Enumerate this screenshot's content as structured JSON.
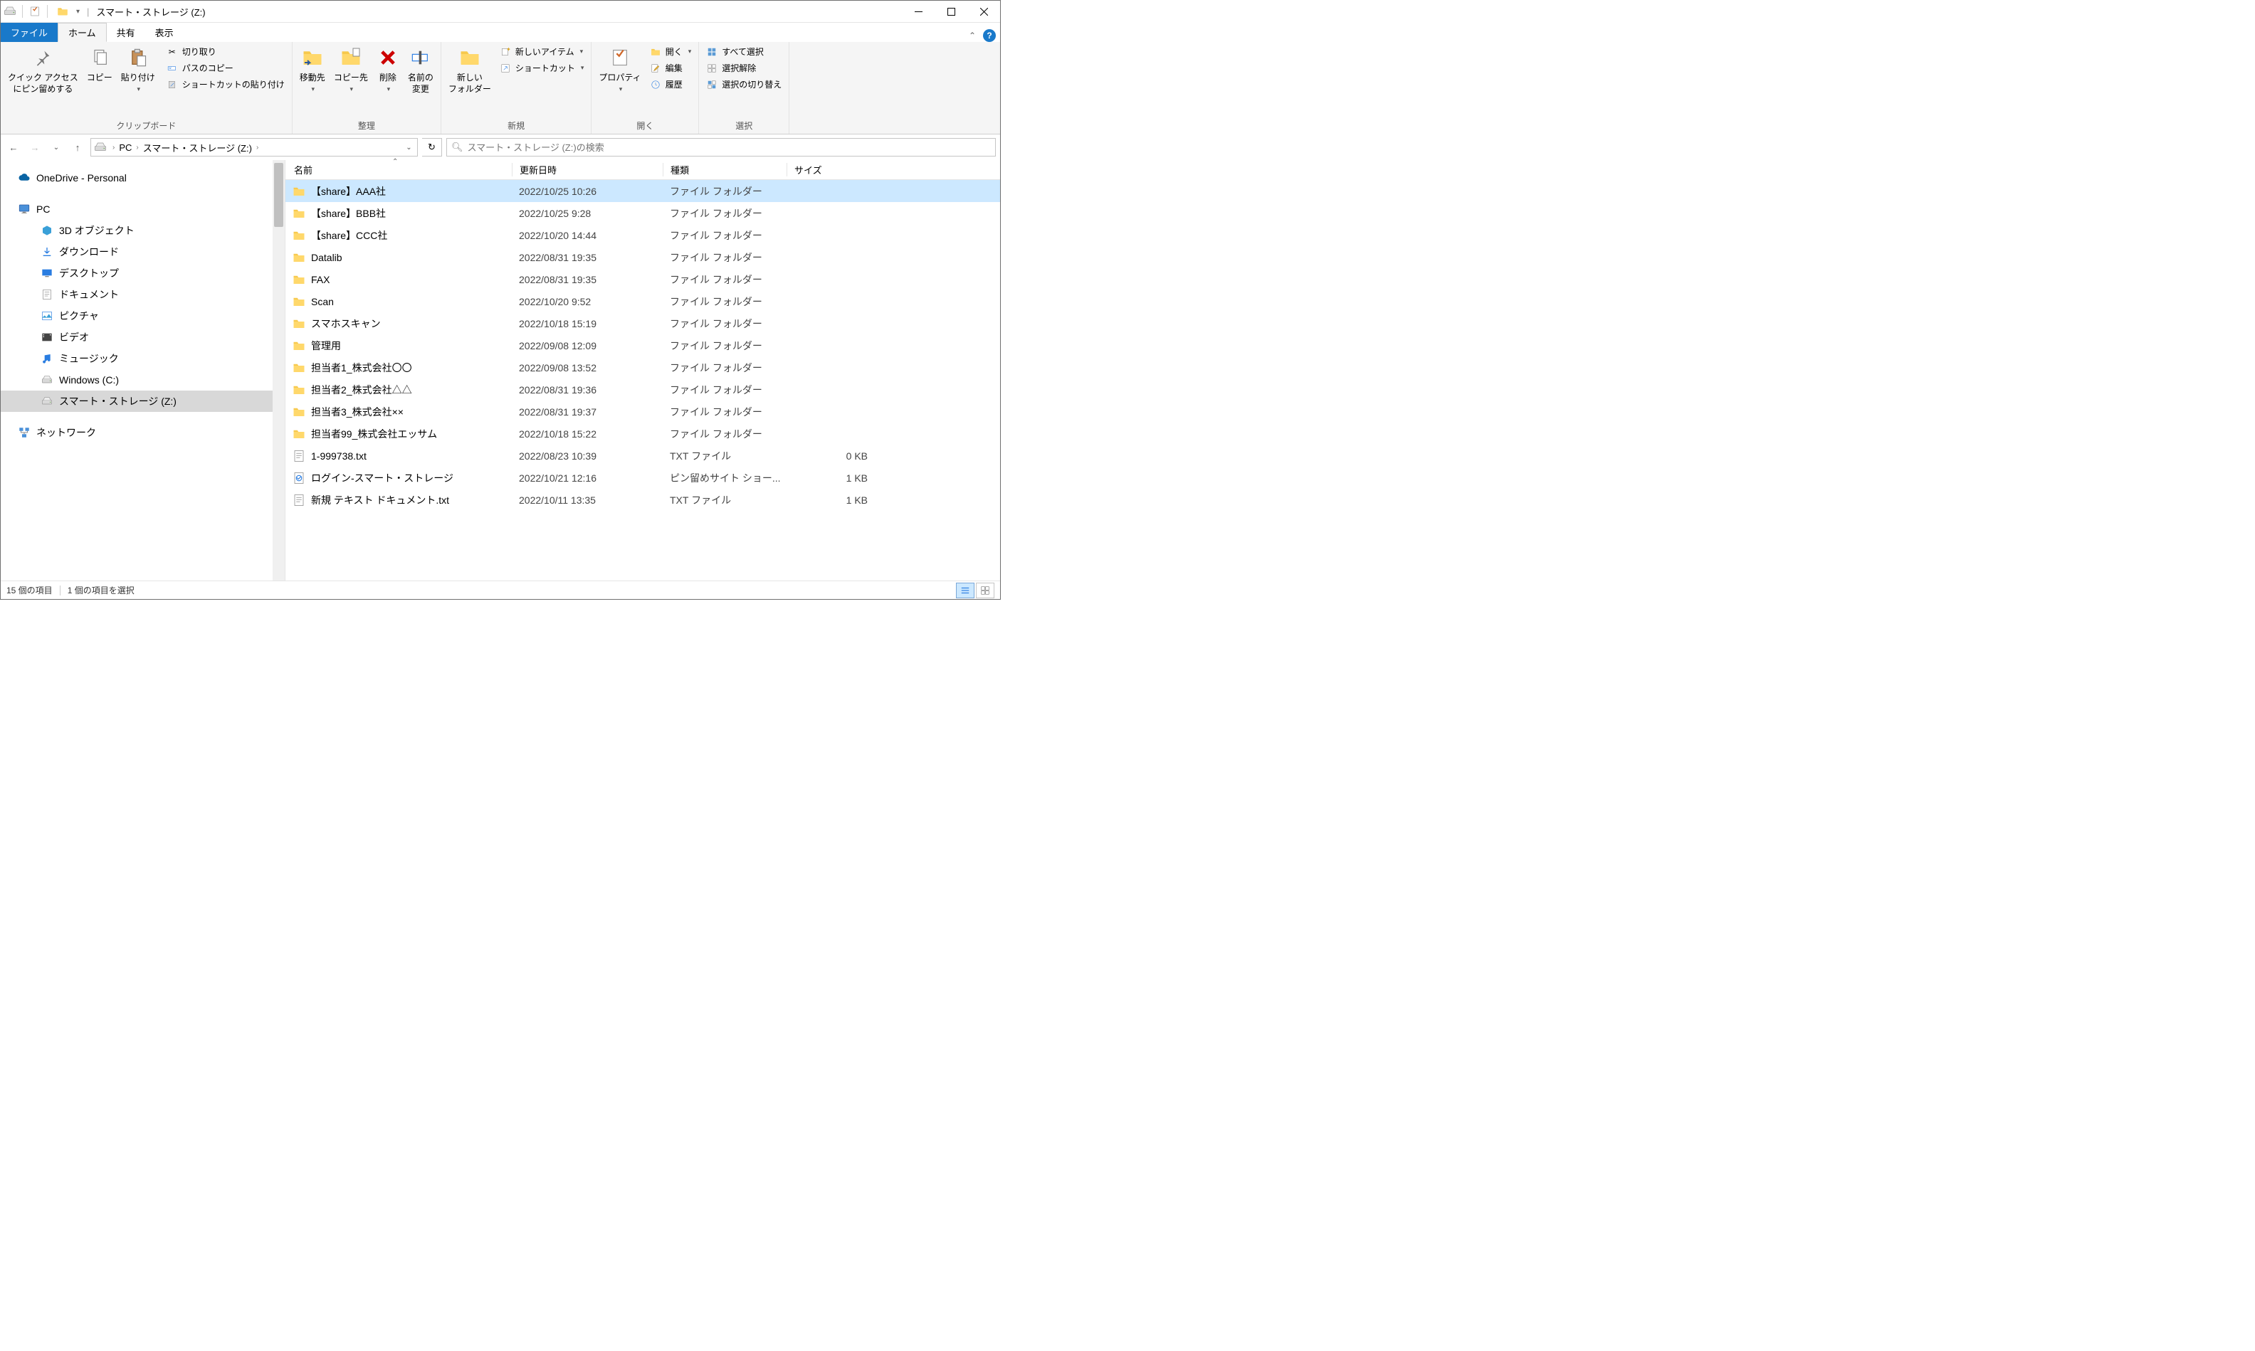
{
  "window": {
    "title": "スマート・ストレージ (Z:)"
  },
  "tabs": {
    "file": "ファイル",
    "home": "ホーム",
    "share": "共有",
    "view": "表示"
  },
  "ribbon": {
    "clipboard": {
      "pin": "クイック アクセス\nにピン留めする",
      "copy": "コピー",
      "paste": "貼り付け",
      "cut": "切り取り",
      "copy_path": "パスのコピー",
      "paste_shortcut": "ショートカットの貼り付け",
      "group": "クリップボード"
    },
    "organize": {
      "move_to": "移動先",
      "copy_to": "コピー先",
      "delete": "削除",
      "rename": "名前の\n変更",
      "group": "整理"
    },
    "new": {
      "new_folder": "新しい\nフォルダー",
      "new_item": "新しいアイテム",
      "shortcut": "ショートカット",
      "group": "新規"
    },
    "open": {
      "properties": "プロパティ",
      "open": "開く",
      "edit": "編集",
      "history": "履歴",
      "group": "開く"
    },
    "select": {
      "select_all": "すべて選択",
      "select_none": "選択解除",
      "invert": "選択の切り替え",
      "group": "選択"
    }
  },
  "breadcrumb": {
    "pc": "PC",
    "drive": "スマート・ストレージ (Z:)"
  },
  "search": {
    "placeholder": "スマート・ストレージ (Z:)の検索"
  },
  "tree": {
    "onedrive": "OneDrive - Personal",
    "pc": "PC",
    "objects3d": "3D オブジェクト",
    "downloads": "ダウンロード",
    "desktop": "デスクトップ",
    "documents": "ドキュメント",
    "pictures": "ピクチャ",
    "videos": "ビデオ",
    "music": "ミュージック",
    "cdrive": "Windows (C:)",
    "zdrive": "スマート・ストレージ (Z:)",
    "network": "ネットワーク"
  },
  "columns": {
    "name": "名前",
    "date": "更新日時",
    "type": "種類",
    "size": "サイズ"
  },
  "files": [
    {
      "icon": "folder",
      "name": "【share】AAA社",
      "date": "2022/10/25 10:26",
      "type": "ファイル フォルダー",
      "size": "",
      "selected": true
    },
    {
      "icon": "folder",
      "name": "【share】BBB社",
      "date": "2022/10/25 9:28",
      "type": "ファイル フォルダー",
      "size": ""
    },
    {
      "icon": "folder",
      "name": "【share】CCC社",
      "date": "2022/10/20 14:44",
      "type": "ファイル フォルダー",
      "size": ""
    },
    {
      "icon": "folder",
      "name": "Datalib",
      "date": "2022/08/31 19:35",
      "type": "ファイル フォルダー",
      "size": ""
    },
    {
      "icon": "folder",
      "name": "FAX",
      "date": "2022/08/31 19:35",
      "type": "ファイル フォルダー",
      "size": ""
    },
    {
      "icon": "folder",
      "name": "Scan",
      "date": "2022/10/20 9:52",
      "type": "ファイル フォルダー",
      "size": ""
    },
    {
      "icon": "folder",
      "name": "スマホスキャン",
      "date": "2022/10/18 15:19",
      "type": "ファイル フォルダー",
      "size": ""
    },
    {
      "icon": "folder",
      "name": "管理用",
      "date": "2022/09/08 12:09",
      "type": "ファイル フォルダー",
      "size": ""
    },
    {
      "icon": "folder",
      "name": "担当者1_株式会社〇〇",
      "date": "2022/09/08 13:52",
      "type": "ファイル フォルダー",
      "size": ""
    },
    {
      "icon": "folder",
      "name": "担当者2_株式会社△△",
      "date": "2022/08/31 19:36",
      "type": "ファイル フォルダー",
      "size": ""
    },
    {
      "icon": "folder",
      "name": "担当者3_株式会社××",
      "date": "2022/08/31 19:37",
      "type": "ファイル フォルダー",
      "size": ""
    },
    {
      "icon": "folder",
      "name": "担当者99_株式会社エッサム",
      "date": "2022/10/18 15:22",
      "type": "ファイル フォルダー",
      "size": ""
    },
    {
      "icon": "txt",
      "name": "1-999738.txt",
      "date": "2022/08/23 10:39",
      "type": "TXT ファイル",
      "size": "0 KB"
    },
    {
      "icon": "url",
      "name": "ログイン-スマート・ストレージ",
      "date": "2022/10/21 12:16",
      "type": "ピン留めサイト ショー...",
      "size": "1 KB"
    },
    {
      "icon": "txt",
      "name": "新規 テキスト ドキュメント.txt",
      "date": "2022/10/11 13:35",
      "type": "TXT ファイル",
      "size": "1 KB"
    }
  ],
  "status": {
    "count": "15 個の項目",
    "selection": "1 個の項目を選択"
  }
}
